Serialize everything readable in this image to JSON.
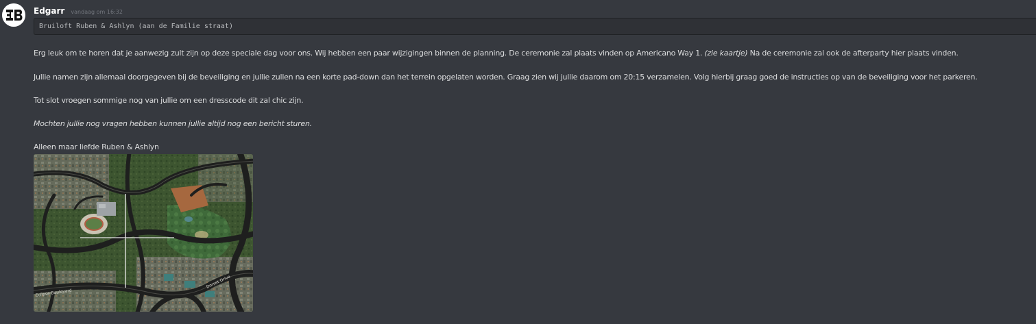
{
  "message": {
    "username": "Edgarr",
    "timestamp": "vandaag om 16:32",
    "code_text": "Bruiloft Ruben & Ashlyn (aan de Familie straat)",
    "paragraph1_a": "Erg leuk om te horen dat je aanwezig zult zijn op deze speciale dag voor ons. Wij hebben een paar wijzigingen binnen de planning. De ceremonie zal plaats vinden op Americano Way 1. ",
    "paragraph1_em": "(zie kaartje)",
    "paragraph1_b": " Na de ceremonie zal ook de afterparty hier plaats vinden.",
    "paragraph2": "Jullie namen zijn allemaal doorgegeven bij de beveiliging en jullie zullen na een korte pad-down dan het terrein opgelaten worden. Graag zien wij jullie daarom om 20:15 verzamelen. Volg hierbij graag goed de instructies op van de beveiliging voor het parkeren.",
    "paragraph3": "Tot slot vroegen sommige nog van jullie om een dresscode dit zal chic zijn.",
    "paragraph4": "Mochten jullie nog vragen hebben kunnen jullie altijd nog een bericht sturen.",
    "signature": "Alleen maar liefde Ruben & Ashlyn"
  },
  "colors": {
    "background": "#36393f",
    "username": "#ffffff",
    "timestamp": "#72767d",
    "text": "#dcddde",
    "codeblock_bg": "#2f3136"
  },
  "attachment": {
    "icon": "map-image",
    "map_labels": {
      "left_bottom": "Eclipse Boulevard",
      "right_road": "Dorset Drive"
    }
  }
}
